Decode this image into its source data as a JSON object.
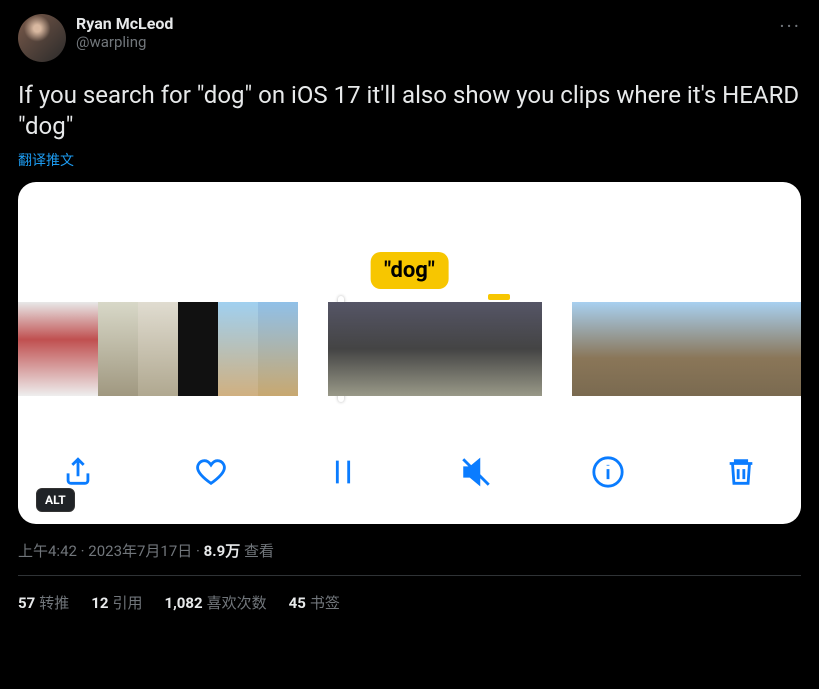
{
  "author": {
    "display_name": "Ryan McLeod",
    "handle": "@warpling"
  },
  "more_label": "···",
  "tweet_text": "If you search for \"dog\" on iOS 17 it'll also show you clips where it's HEARD \"dog\"",
  "translate_label": "翻译推文",
  "media": {
    "search_term": "\"dog\"",
    "alt_badge": "ALT",
    "toolbar": {
      "share": "Share",
      "like": "Like",
      "pause": "Pause",
      "mute": "Mute",
      "info": "Info",
      "delete": "Delete"
    }
  },
  "timestamp": "上午4:42 · 2023年7月17日",
  "views_count": "8.9万",
  "views_label": " 查看",
  "stats": {
    "retweets_n": "57",
    "retweets_l": "转推",
    "quotes_n": "12",
    "quotes_l": "引用",
    "likes_n": "1,082",
    "likes_l": "喜欢次数",
    "bookmarks_n": "45",
    "bookmarks_l": "书签"
  }
}
